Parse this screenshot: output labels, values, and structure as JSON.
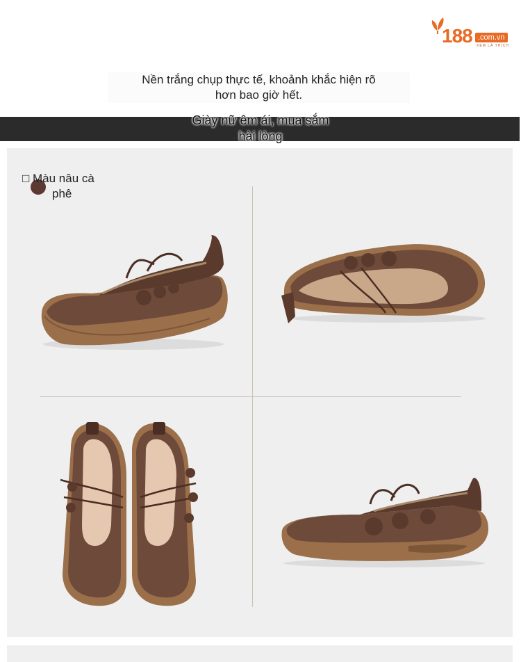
{
  "brand": {
    "logo_number": "188",
    "logo_domain": ".com.vn",
    "logo_tagline": "XEM LÀ THÍCH"
  },
  "intro": {
    "line1": "Nền trắng chụp thực tế, khoảnh khắc hiện rõ",
    "line2": "hơn bao giờ hết."
  },
  "banner": {
    "line1": "Giày nữ êm ái, mua sắm",
    "line2": "hài lòng"
  },
  "product": {
    "color_icon": "□",
    "color_line1": "Màu nâu cà",
    "color_line2": "phê",
    "color_hex": "#5b3a34",
    "images": [
      "side-view",
      "top-angle-view",
      "front-pair-view",
      "side-view-right"
    ]
  },
  "colors": {
    "accent": "#e96a24",
    "banner_bg": "#2b2b2b",
    "panel_bg": "#efefef",
    "leather": "#6e4a3a",
    "sole": "#9a6f4a"
  }
}
